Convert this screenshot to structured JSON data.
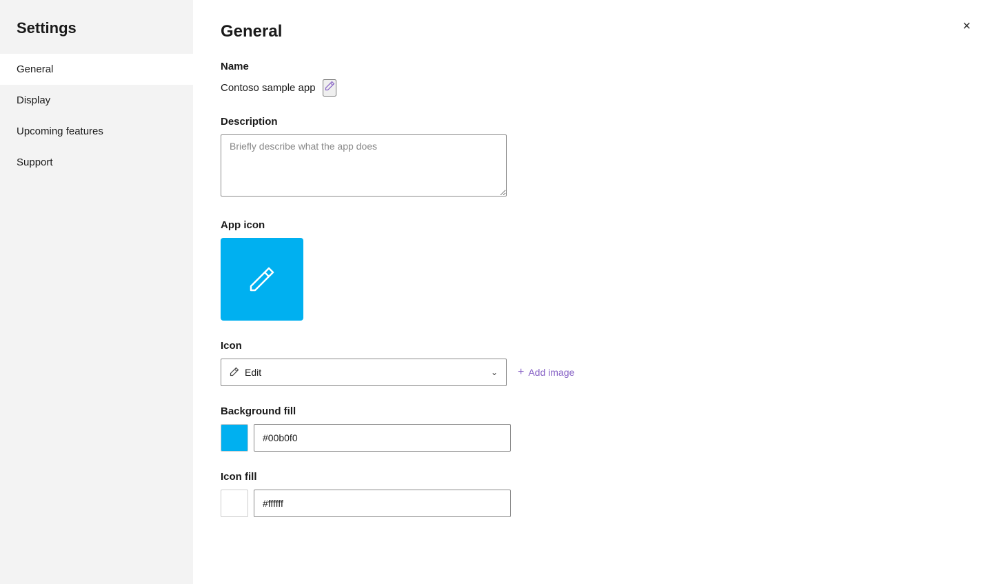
{
  "sidebar": {
    "title": "Settings",
    "items": [
      {
        "id": "general",
        "label": "General",
        "active": true
      },
      {
        "id": "display",
        "label": "Display",
        "active": false
      },
      {
        "id": "upcoming-features",
        "label": "Upcoming features",
        "active": false
      },
      {
        "id": "support",
        "label": "Support",
        "active": false
      }
    ]
  },
  "main": {
    "title": "General",
    "close_label": "×",
    "sections": {
      "name": {
        "label": "Name",
        "value": "Contoso sample app",
        "edit_icon": "✏"
      },
      "description": {
        "label": "Description",
        "placeholder": "Briefly describe what the app does"
      },
      "app_icon": {
        "label": "App icon",
        "bg_color": "#00b0f0"
      },
      "icon": {
        "label": "Icon",
        "selected": "Edit",
        "add_image_label": "Add image"
      },
      "background_fill": {
        "label": "Background fill",
        "color": "#00b0f0",
        "value": "#00b0f0"
      },
      "icon_fill": {
        "label": "Icon fill",
        "color": "#ffffff",
        "value": "#ffffff"
      }
    }
  }
}
